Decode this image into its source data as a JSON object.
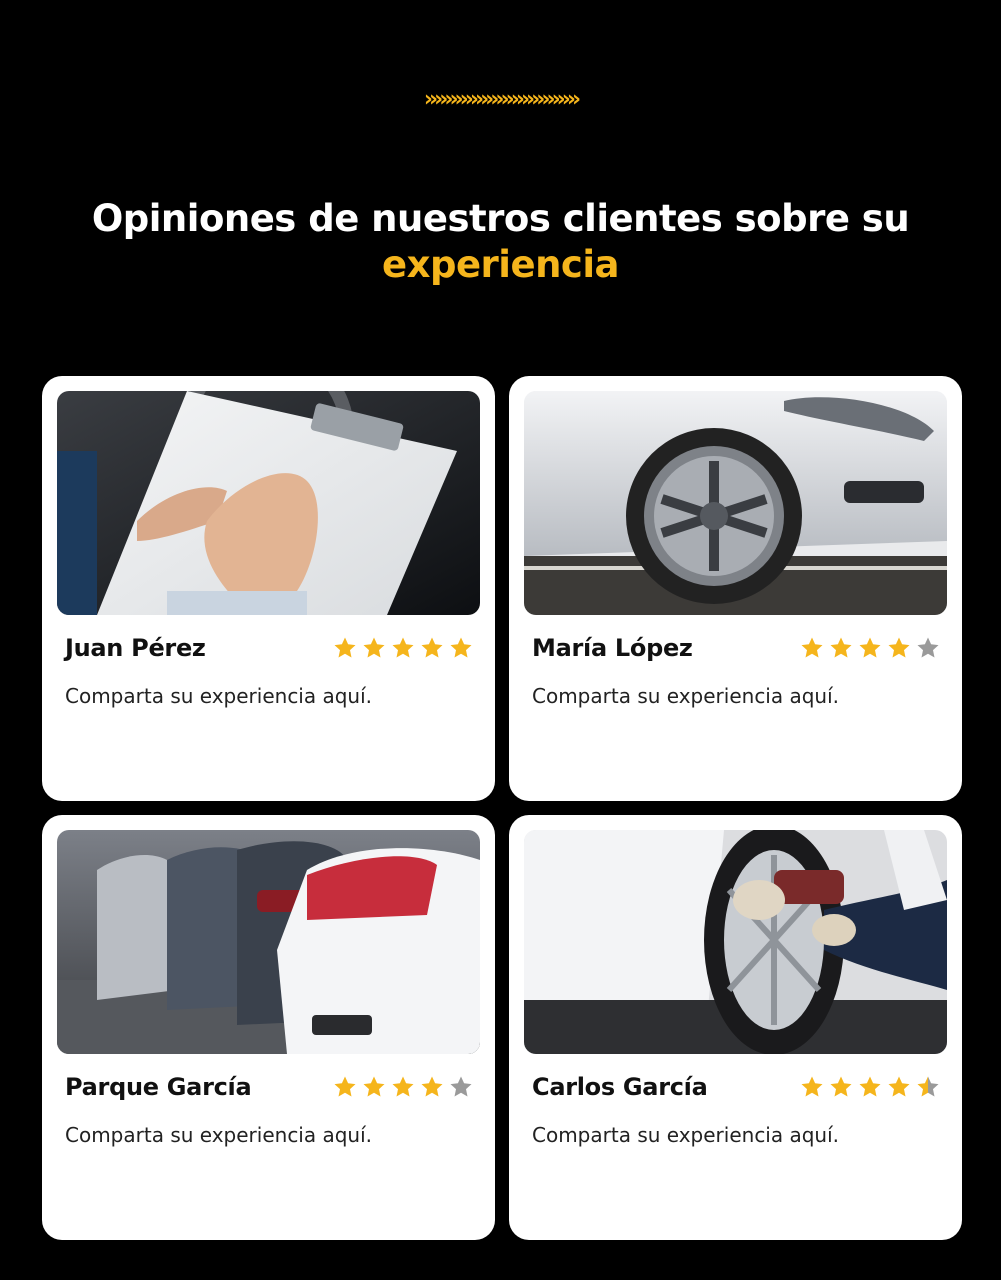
{
  "header": {
    "chevrons": "»»»»»»»»»»»»»»»",
    "title_line1": "Opiniones de nuestros clientes sobre su",
    "title_line2": "experiencia",
    "accent_color": "#f5b51c"
  },
  "reviews": [
    {
      "name": "Juan Pérez",
      "rating": 5,
      "text": "Comparta su experiencia aquí.",
      "photo": "clipboard-inspection-photo"
    },
    {
      "name": "María López",
      "rating": 4,
      "text": "Comparta su experiencia aquí.",
      "photo": "white-car-wheel-photo"
    },
    {
      "name": "Parque García",
      "rating": 4,
      "text": "Comparta su experiencia aquí.",
      "photo": "parked-cars-photo"
    },
    {
      "name": "Carlos García",
      "rating": 4.5,
      "text": "Comparta su experiencia aquí.",
      "photo": "tire-change-photo"
    }
  ],
  "colors": {
    "background": "#000000",
    "card": "#ffffff",
    "star_filled": "#f5b51c",
    "star_empty": "#9a9a9a"
  }
}
